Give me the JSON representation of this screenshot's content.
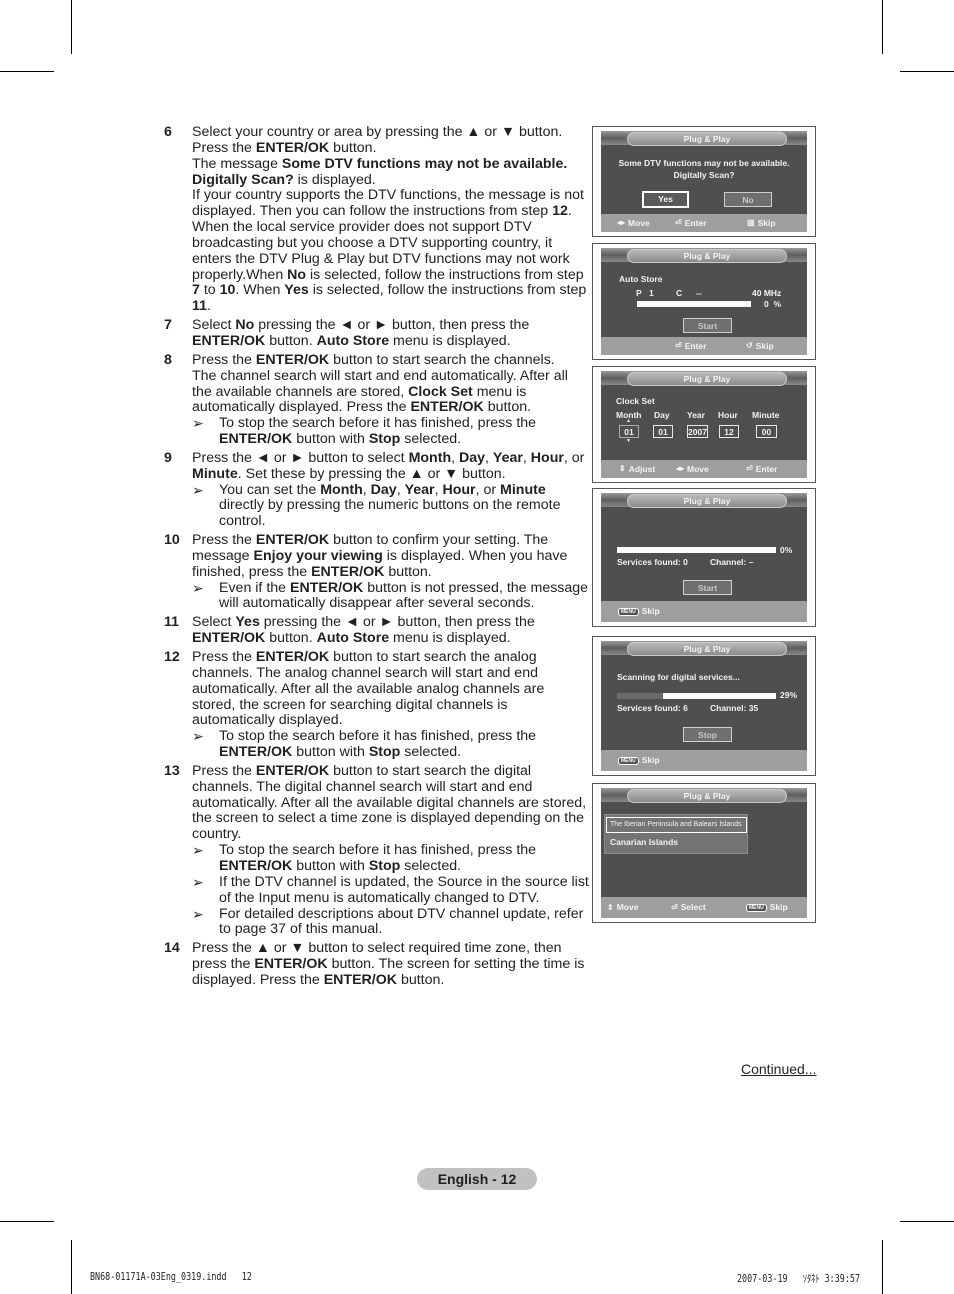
{
  "steps": [
    {
      "num": "6",
      "paras": [
        [
          {
            "t": "Select your country or area by pressing the ▲ or ▼ button. Press the "
          },
          {
            "t": "ENTER/OK",
            "b": true
          },
          {
            "t": " button."
          }
        ],
        [
          {
            "t": "The message "
          },
          {
            "t": "Some DTV functions may not be available. Digitally Scan?",
            "b": true
          },
          {
            "t": " is displayed."
          }
        ],
        [
          {
            "t": "If your country supports the DTV functions, the message is not displayed. Then you can follow the instructions from step "
          },
          {
            "t": "12",
            "b": true
          },
          {
            "t": ". When the local service provider does not support DTV broadcasting but you choose a DTV supporting country, it enters the DTV Plug & Play but DTV functions may not work properly.When "
          },
          {
            "t": "No",
            "b": true
          },
          {
            "t": " is selected, follow the instructions from step "
          },
          {
            "t": "7",
            "b": true
          },
          {
            "t": " to "
          },
          {
            "t": "10",
            "b": true
          },
          {
            "t": ". When "
          },
          {
            "t": "Yes",
            "b": true
          },
          {
            "t": " is selected, follow the instructions from step "
          },
          {
            "t": "11",
            "b": true
          },
          {
            "t": "."
          }
        ]
      ],
      "notes": []
    },
    {
      "num": "7",
      "paras": [
        [
          {
            "t": "Select "
          },
          {
            "t": "No",
            "b": true
          },
          {
            "t": " pressing the ◄ or ► button, then press the "
          },
          {
            "t": "ENTER/OK",
            "b": true
          },
          {
            "t": " button. "
          },
          {
            "t": "Auto Store",
            "b": true
          },
          {
            "t": " menu is displayed."
          }
        ]
      ],
      "notes": []
    },
    {
      "num": "8",
      "paras": [
        [
          {
            "t": "Press the "
          },
          {
            "t": "ENTER/OK",
            "b": true
          },
          {
            "t": " button to start search the channels."
          }
        ],
        [
          {
            "t": "The channel search will start and end automatically. After all the available channels are stored, "
          },
          {
            "t": "Clock Set",
            "b": true
          },
          {
            "t": " menu is automatically displayed. Press the "
          },
          {
            "t": "ENTER/OK",
            "b": true
          },
          {
            "t": " button."
          }
        ]
      ],
      "notes": [
        [
          {
            "t": "To stop the search before it has finished, press the "
          },
          {
            "t": "ENTER/OK",
            "b": true
          },
          {
            "t": " button with "
          },
          {
            "t": "Stop",
            "b": true
          },
          {
            "t": " selected."
          }
        ]
      ]
    },
    {
      "num": "9",
      "paras": [
        [
          {
            "t": "Press the ◄ or ► button to select "
          },
          {
            "t": "Month",
            "b": true
          },
          {
            "t": ", "
          },
          {
            "t": "Day",
            "b": true
          },
          {
            "t": ", "
          },
          {
            "t": "Year",
            "b": true
          },
          {
            "t": ", "
          },
          {
            "t": "Hour",
            "b": true
          },
          {
            "t": ", or "
          },
          {
            "t": "Minute",
            "b": true
          },
          {
            "t": ". Set these by pressing the ▲ or ▼ button."
          }
        ]
      ],
      "notes": [
        [
          {
            "t": "You can set the "
          },
          {
            "t": "Month",
            "b": true
          },
          {
            "t": ", "
          },
          {
            "t": "Day",
            "b": true
          },
          {
            "t": ", "
          },
          {
            "t": "Year",
            "b": true
          },
          {
            "t": ", "
          },
          {
            "t": "Hour",
            "b": true
          },
          {
            "t": ", or "
          },
          {
            "t": "Minute",
            "b": true
          },
          {
            "t": " directly by pressing the numeric buttons on the remote control."
          }
        ]
      ]
    },
    {
      "num": "10",
      "paras": [
        [
          {
            "t": "Press the "
          },
          {
            "t": "ENTER/OK",
            "b": true
          },
          {
            "t": " button to confirm your setting. The message "
          },
          {
            "t": "Enjoy your viewing",
            "b": true
          },
          {
            "t": " is displayed. When you have finished, press the "
          },
          {
            "t": "ENTER/OK",
            "b": true
          },
          {
            "t": " button."
          }
        ]
      ],
      "notes": [
        [
          {
            "t": "Even if the "
          },
          {
            "t": "ENTER/OK",
            "b": true
          },
          {
            "t": " button is not pressed, the message will automatically disappear after several seconds."
          }
        ]
      ]
    },
    {
      "num": "11",
      "paras": [
        [
          {
            "t": "Select "
          },
          {
            "t": "Yes",
            "b": true
          },
          {
            "t": " pressing the ◄ or ► button, then press the "
          },
          {
            "t": "ENTER/OK",
            "b": true
          },
          {
            "t": " button. "
          },
          {
            "t": "Auto Store",
            "b": true
          },
          {
            "t": " menu is displayed."
          }
        ]
      ],
      "notes": []
    },
    {
      "num": "12",
      "paras": [
        [
          {
            "t": "Press the "
          },
          {
            "t": "ENTER/OK",
            "b": true
          },
          {
            "t": " button to start search the analog channels. The analog channel search will start and end automatically. After all the available analog channels are stored, the screen for searching digital channels is automatically displayed."
          }
        ]
      ],
      "notes": [
        [
          {
            "t": "To stop the search before it has finished, press the "
          },
          {
            "t": "ENTER/OK",
            "b": true
          },
          {
            "t": " button with "
          },
          {
            "t": "Stop",
            "b": true
          },
          {
            "t": " selected."
          }
        ]
      ]
    },
    {
      "num": "13",
      "paras": [
        [
          {
            "t": "Press the "
          },
          {
            "t": "ENTER/OK",
            "b": true
          },
          {
            "t": " button to start search the digital channels. The digital channel search will start and end automatically. After all the available digital channels are stored, the screen to select a time zone is displayed depending on the country."
          }
        ]
      ],
      "notes": [
        [
          {
            "t": "To stop the search before it has finished, press the "
          },
          {
            "t": "ENTER/OK",
            "b": true
          },
          {
            "t": " button with "
          },
          {
            "t": "Stop",
            "b": true
          },
          {
            "t": " selected."
          }
        ],
        [
          {
            "t": "If the DTV channel is updated, the Source in the source list of the Input menu is automatically changed to DTV."
          }
        ],
        [
          {
            "t": "For detailed descriptions about DTV channel update, refer to page 37 of this manual."
          }
        ]
      ]
    },
    {
      "num": "14",
      "paras": [
        [
          {
            "t": "Press the ▲ or ▼ button to select required time zone, then press the "
          },
          {
            "t": "ENTER/OK",
            "b": true
          },
          {
            "t": " button. The screen for setting the time is displayed. Press the "
          },
          {
            "t": "ENTER/OK",
            "b": true
          },
          {
            "t": " button."
          }
        ]
      ],
      "notes": []
    }
  ],
  "note_arrow": "➢",
  "screens": {
    "dtv_prompt": {
      "title": "Plug & Play",
      "message_line1": "Some DTV functions may not be available.",
      "message_line2": "Digitally Scan?",
      "yes_label": "Yes",
      "no_label": "No",
      "selected": "Yes",
      "footer": {
        "move": "Move",
        "enter": "Enter",
        "skip": "Skip"
      }
    },
    "auto_store": {
      "title": "Plug & Play",
      "heading": "Auto Store",
      "p_label": "P",
      "p_value": "1",
      "c_label": "C",
      "c_value": "--",
      "frequency": "40 MHz",
      "progress_percent": 0,
      "progress_text": "0  %",
      "start_label": "Start",
      "footer": {
        "enter": "Enter",
        "skip": "Skip"
      }
    },
    "clock_set": {
      "title": "Plug & Play",
      "heading": "Clock Set",
      "fields": [
        {
          "label": "Month",
          "value": "01",
          "active": true
        },
        {
          "label": "Day",
          "value": "01"
        },
        {
          "label": "Year",
          "value": "2007"
        },
        {
          "label": "Hour",
          "value": "12"
        },
        {
          "label": "Minute",
          "value": "00"
        }
      ],
      "footer": {
        "adjust": "Adjust",
        "move": "Move",
        "enter": "Enter"
      }
    },
    "digital_idle": {
      "title": "Plug & Play",
      "progress_percent": 0,
      "progress_text": "0%",
      "services_found": "Services found: 0",
      "channel": "Channel: –",
      "start_label": "Start",
      "menu_key": "MENU",
      "footer": {
        "skip": "Skip"
      }
    },
    "digital_scanning": {
      "title": "Plug & Play",
      "status": "Scanning for digital services...",
      "progress_percent": 29,
      "progress_text": "29%",
      "services_found": "Services found: 6",
      "channel": "Channel: 35",
      "stop_label": "Stop",
      "menu_key": "MENU",
      "footer": {
        "skip": "Skip"
      }
    },
    "time_zone": {
      "title": "Plug & Play",
      "options": [
        "The Iberian Peninsula and Balears Islands",
        "Canarian Islands"
      ],
      "selected_index": 0,
      "menu_key": "MENU",
      "footer": {
        "move": "Move",
        "select": "Select",
        "skip": "Skip"
      }
    }
  },
  "continued": "Continued...",
  "page_label": "English - 12",
  "slug_left": "BN68-01171A-03Eng_0319.indd   12",
  "slug_right": "2007-03-19   ｿﾀﾈﾄ 3:39:57"
}
